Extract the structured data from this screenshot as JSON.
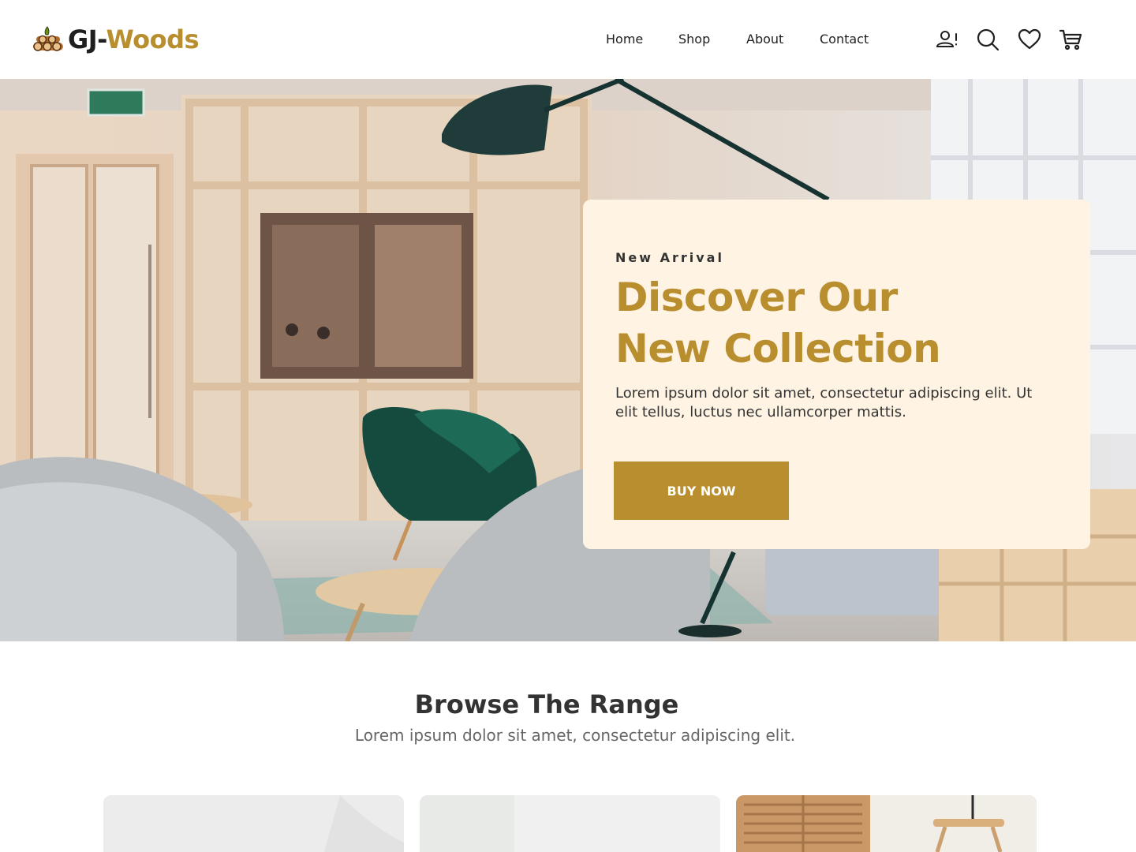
{
  "brand": {
    "name_part1": "GJ-",
    "name_part2": "Woods"
  },
  "nav": {
    "home": "Home",
    "shop": "Shop",
    "about": "About",
    "contact": "Contact"
  },
  "header_icons": [
    "user-alert-icon",
    "search-icon",
    "heart-icon",
    "cart-icon"
  ],
  "hero": {
    "eyebrow": "New Arrival",
    "title_line1": "Discover Our",
    "title_line2": "New Collection",
    "description": "Lorem ipsum dolor sit amet, consectetur adipiscing elit. Ut elit tellus, luctus nec ullamcorper mattis.",
    "button_label": "BUY NOW"
  },
  "browse": {
    "title": "Browse The Range",
    "subtitle": "Lorem ipsum dolor sit amet, consectetur adipiscing elit."
  },
  "colors": {
    "accent": "#B88E2F",
    "card_background": "#FFF3E3",
    "text_dark": "#333333",
    "text_muted": "#666666"
  }
}
